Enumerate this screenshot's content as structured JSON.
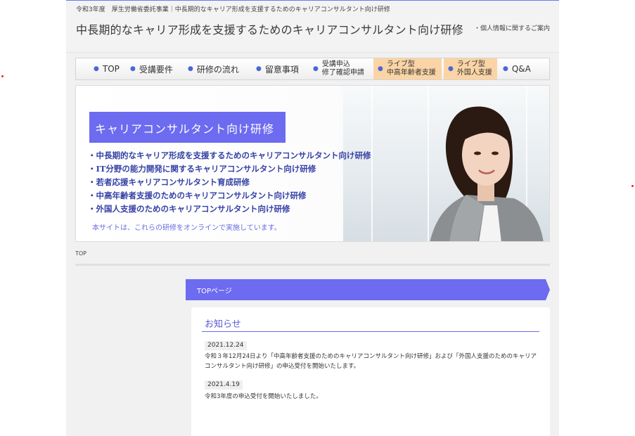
{
  "header": {
    "top_line": "令和3年度　厚生労働省委託事業｜中長期的なキャリア形成を支援するためのキャリアコンサルタント向け研修",
    "title": "中長期的なキャリア形成を支援するためのキャリアコンサルタント向け研修",
    "privacy_link": "・個人情報に関するご案内"
  },
  "nav": {
    "bullet": "●",
    "items": [
      {
        "line1": "TOP",
        "line2": ""
      },
      {
        "line1": "受講要件",
        "line2": ""
      },
      {
        "line1": "研修の流れ",
        "line2": ""
      },
      {
        "line1": "留意事項",
        "line2": ""
      },
      {
        "line1": "受講申込",
        "line2": "修了確認申請"
      },
      {
        "line1": "ライブ型",
        "line2": "中高年齢者支援"
      },
      {
        "line1": "ライブ型",
        "line2": "外国人支援"
      },
      {
        "line1": "Q&A",
        "line2": ""
      }
    ]
  },
  "hero": {
    "title": "キャリアコンサルタント向け研修",
    "list": [
      "・中長期的なキャリア形成を支援するためのキャリアコンサルタント向け研修",
      "・IT分野の能力開発に関するキャリアコンサルタント向け研修",
      "・若者応援キャリアコンサルタント育成研修",
      "・中高年齢者支援のためのキャリアコンサルタント向け研修",
      "・外国人支援のためのキャリアコンサルタント向け研修"
    ],
    "note": "本サイトは、これらの研修をオンラインで実施しています。"
  },
  "breadcrumb": "TOP",
  "section": {
    "ribbon_label": "TOPページ",
    "news_title": "お知らせ",
    "news": [
      {
        "date": "2021.12.24",
        "text": "令和３年12月24日より「中高年齢者支援のためのキャリアコンサルタント向け研修」および「外国人支援のためのキャリアコンサルタント向け研修」の申込受付を開始いたします。"
      },
      {
        "date": "2021.4.19",
        "text": "令和3年度の申込受付を開始いたしました。"
      }
    ]
  },
  "colors": {
    "accent": "#6d6bf0",
    "nav_highlight": "#fbd4a6",
    "background": "#f1f1f1"
  }
}
